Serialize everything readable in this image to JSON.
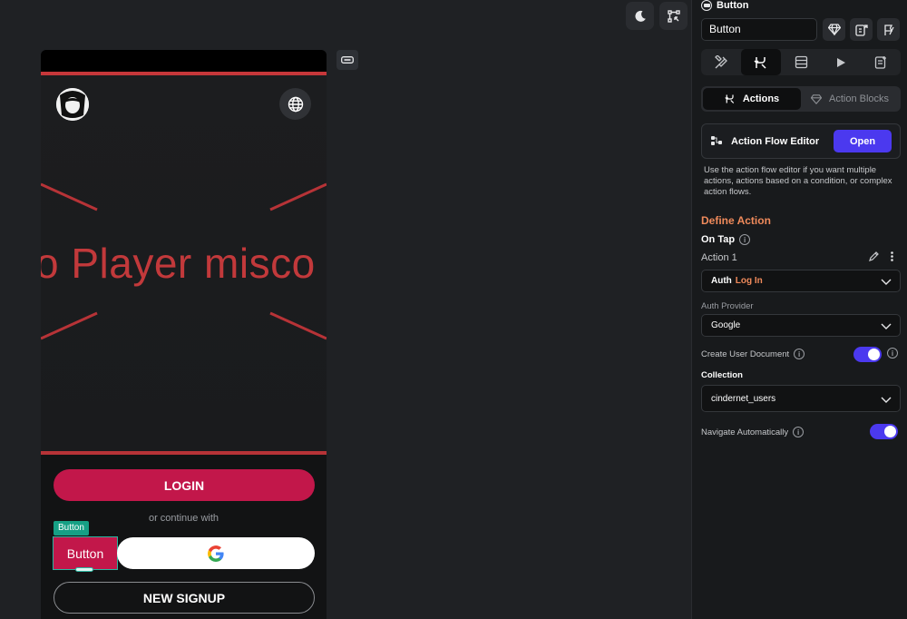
{
  "canvas": {
    "hero_text": "o Player misco",
    "login_label": "LOGIN",
    "or_text": "or continue with",
    "selection_tag": "Button",
    "small_button_label": "Button",
    "signup_label": "NEW SIGNUP",
    "icons": [
      "moon-icon",
      "select-tool-icon",
      "device-badge-icon",
      "avatar",
      "globe-icon",
      "google-logo"
    ],
    "colors": {
      "accent_red": "#c2174a",
      "hero_red": "#c2393b",
      "selection": "#16a085"
    }
  },
  "panel": {
    "widget_type": "Button",
    "widget_name": "Button",
    "tabs": [
      "properties",
      "actions",
      "backend-query",
      "preview",
      "docs"
    ],
    "segment": {
      "actions_label": "Actions",
      "action_blocks_label": "Action Blocks"
    },
    "action_flow_editor": {
      "label": "Action Flow Editor",
      "open_label": "Open",
      "helper": "Use the action flow editor if you want multiple actions, actions based on a condition, or complex action flows."
    },
    "define_action": "Define Action",
    "on_tap": "On Tap",
    "action1": "Action 1",
    "action_type": {
      "category": "Auth",
      "name": "Log In"
    },
    "auth_provider": {
      "label": "Auth Provider",
      "value": "Google"
    },
    "create_user_document": {
      "label": "Create User Document",
      "enabled": true
    },
    "collection": {
      "label": "Collection",
      "value": "cindernet_users"
    },
    "navigate_automatically": {
      "label": "Navigate Automatically",
      "enabled": true
    },
    "colors": {
      "primary": "#4b39ef",
      "define_action": "#ef8a5b"
    }
  }
}
